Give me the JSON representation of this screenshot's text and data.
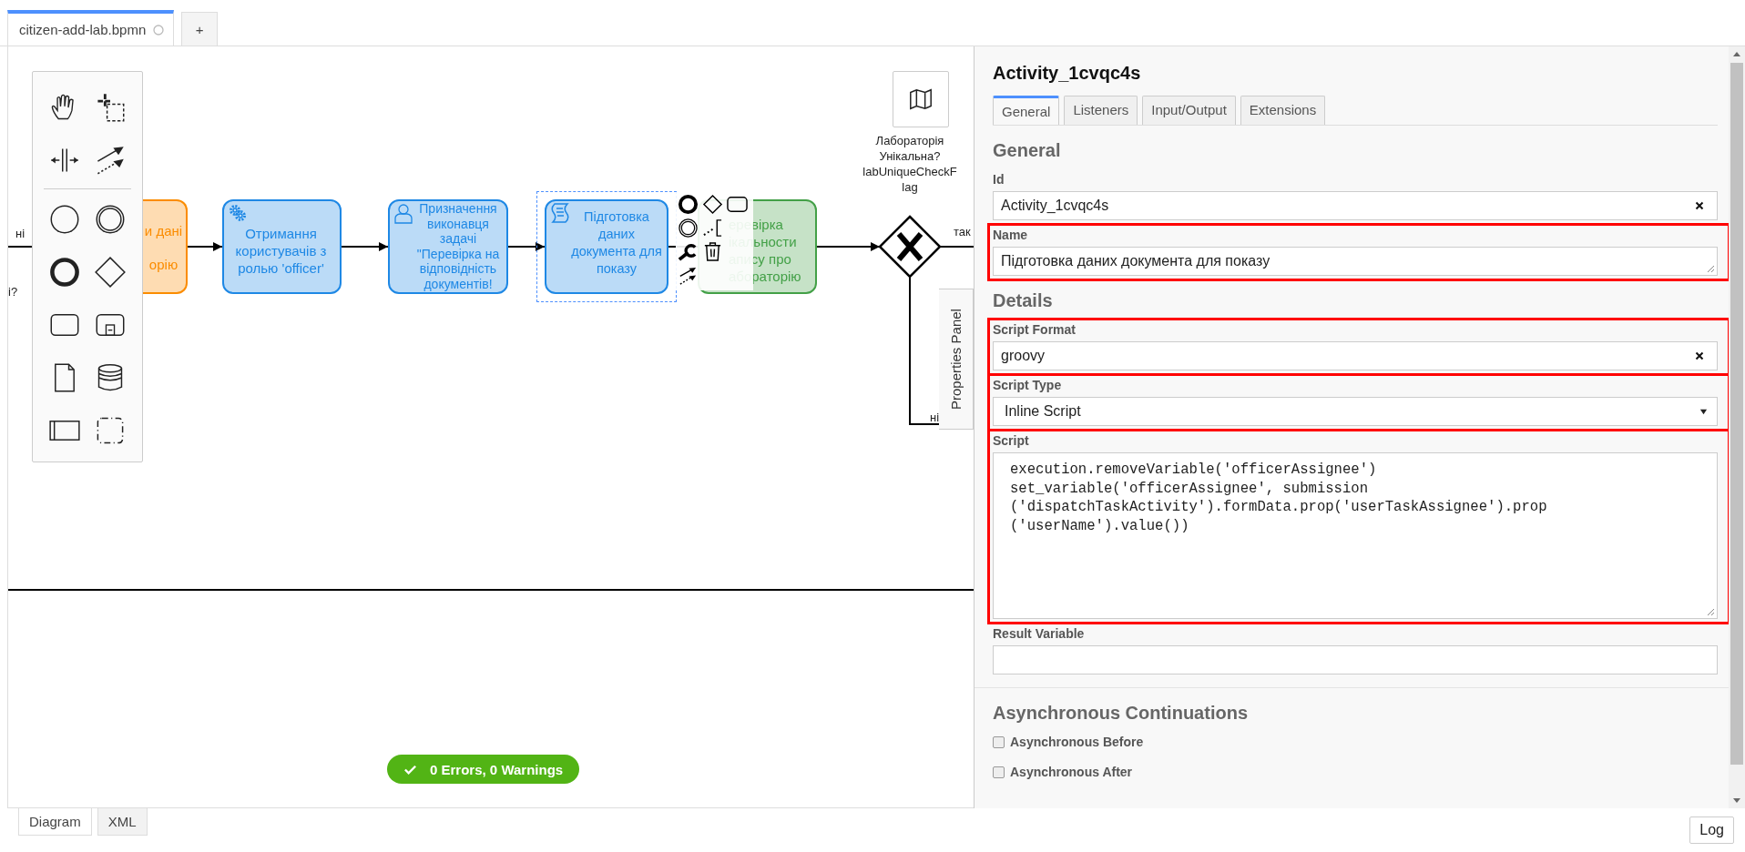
{
  "file_tabs": [
    {
      "label": "citizen-add-lab.bpmn",
      "selected": true,
      "unsaved": true
    },
    {
      "label": "+",
      "selected": false,
      "unsaved": false
    }
  ],
  "diagram": {
    "flow_labels": [
      "ні",
      "і?",
      "так",
      "ні"
    ],
    "tasks": [
      {
        "kind": "none",
        "color": "#fb8c00",
        "selected": false,
        "label_lines": [
          "и дані",
          "орію"
        ]
      },
      {
        "kind": "service",
        "color": "#1e88e5",
        "selected": false,
        "label_lines": [
          "Отримання",
          "користувачів з",
          "ролью 'officer'"
        ]
      },
      {
        "kind": "user",
        "color": "#1e88e5",
        "selected": false,
        "label_lines": [
          "Призначення",
          "виконавця",
          "задачі",
          "\"Перевірка на",
          "відповідність",
          "документів!"
        ]
      },
      {
        "kind": "script",
        "color": "#1e88e5",
        "selected": true,
        "label_lines": [
          "Підготовка",
          "даних",
          "документа для",
          "показу"
        ]
      },
      {
        "kind": "none",
        "color": "#43a047",
        "selected": false,
        "label_lines": [
          "еревірка",
          "ікальности",
          "апису про",
          "абораторію"
        ]
      }
    ],
    "gateway": {
      "kind": "exclusive",
      "label_lines": [
        "Лабораторія",
        "Унікальна?",
        "labUniqueCheckF",
        "lag"
      ]
    },
    "panel_toggle": "Properties Panel",
    "validation": "0 Errors, 0 Warnings"
  },
  "properties": {
    "title": "Activity_1cvqc4s",
    "tabs": [
      {
        "label": "General",
        "selected": true
      },
      {
        "label": "Listeners",
        "selected": false
      },
      {
        "label": "Input/Output",
        "selected": false
      },
      {
        "label": "Extensions",
        "selected": false
      }
    ],
    "groups": [
      {
        "heading": "General",
        "fields": [
          {
            "kind": "input",
            "label": "Id",
            "value": "Activity_1cvqc4s",
            "clearable": true
          },
          {
            "kind": "textarea",
            "label": "Name",
            "value": "Підготовка даних документа для показу",
            "highlighted": true
          }
        ]
      },
      {
        "heading": "Details",
        "fields": [
          {
            "kind": "input",
            "label": "Script Format",
            "value": "groovy",
            "clearable": true,
            "highlighted": true
          },
          {
            "kind": "select",
            "label": "Script Type",
            "value": "Inline Script",
            "highlighted": true
          },
          {
            "kind": "code",
            "label": "Script",
            "lines": [
              "execution.removeVariable('officerAssignee')",
              "set_variable('officerAssignee', submission",
              "('dispatchTaskActivity').formData.prop('userTaskAssignee').prop",
              "('userName').value())"
            ],
            "highlighted": true
          },
          {
            "kind": "input",
            "label": "Result Variable"
          }
        ]
      }
    ],
    "async": {
      "heading": "Asynchronous Continuations",
      "options": [
        {
          "label": "Asynchronous Before",
          "checked": false
        },
        {
          "label": "Asynchronous After",
          "checked": false
        }
      ]
    }
  },
  "bottom_tabs": [
    {
      "label": "Diagram",
      "selected": true
    },
    {
      "label": "XML",
      "selected": false
    }
  ],
  "log_button": "Log"
}
